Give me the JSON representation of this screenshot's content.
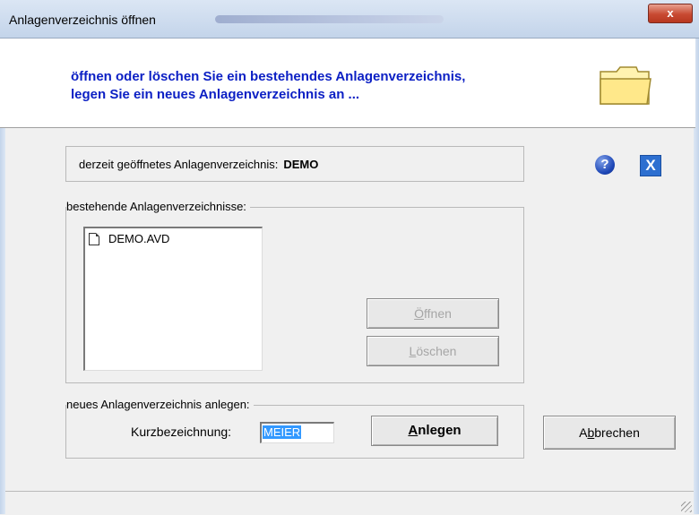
{
  "window": {
    "title": "Anlagenverzeichnis öffnen",
    "close_symbol": "x"
  },
  "header": {
    "line1": "öffnen oder löschen Sie ein bestehendes Anlagenverzeichnis,",
    "line2": "legen Sie ein neues Anlagenverzeichnis an ...",
    "icon": "folder-icon"
  },
  "current": {
    "label": "derzeit geöffnetes Anlagenverzeichnis:",
    "value": "DEMO"
  },
  "toolbar": {
    "help_symbol": "?",
    "close_symbol": "X"
  },
  "existing": {
    "legend": "bestehende Anlagenverzeichnisse:",
    "items": [
      "DEMO.AVD"
    ],
    "open_button": {
      "access": "Ö",
      "rest": "ffnen",
      "enabled": false
    },
    "delete_button": {
      "access": "L",
      "rest": "öschen",
      "enabled": false
    }
  },
  "new": {
    "legend": "neues Anlagenverzeichnis anlegen:",
    "field_label": "Kurzbezeichnung:",
    "field_value": "MEIER",
    "create_button": {
      "access": "A",
      "rest": "nlegen"
    }
  },
  "cancel_button": {
    "pre": "A",
    "access": "b",
    "rest": "brechen"
  },
  "colors": {
    "header_text": "#0b1fc4",
    "selection": "#3399ff"
  }
}
